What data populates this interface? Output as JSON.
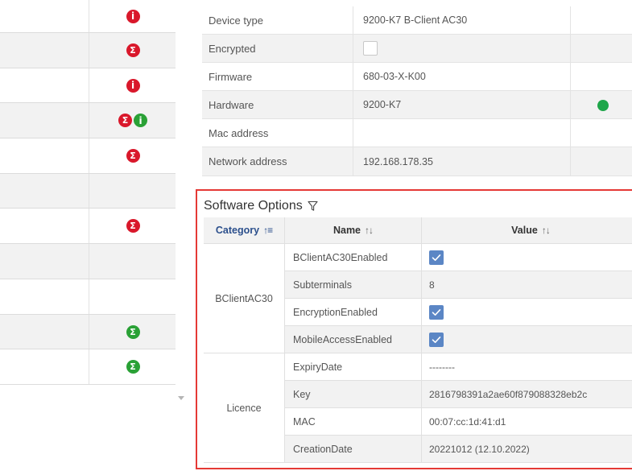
{
  "left_list": {
    "rows": [
      {
        "badges": [
          "info-red"
        ],
        "shaded": false
      },
      {
        "badges": [
          "sigma-red"
        ],
        "shaded": true
      },
      {
        "badges": [
          "info-red"
        ],
        "shaded": false
      },
      {
        "badges": [
          "sigma-red",
          "info-green"
        ],
        "shaded": true
      },
      {
        "badges": [
          "sigma-red"
        ],
        "shaded": false
      },
      {
        "badges": [],
        "shaded": true
      },
      {
        "badges": [
          "sigma-red"
        ],
        "shaded": false
      },
      {
        "badges": [],
        "shaded": true
      },
      {
        "badges": [],
        "shaded": false
      },
      {
        "badges": [
          "sigma-green"
        ],
        "shaded": true
      },
      {
        "badges": [
          "sigma-green"
        ],
        "shaded": false
      }
    ]
  },
  "device": {
    "rows": [
      {
        "label": "Device type",
        "value": "9200-K7 B-Client AC30",
        "kind": "text"
      },
      {
        "label": "Encrypted",
        "value": "",
        "kind": "checkbox",
        "checked": false
      },
      {
        "label": "Firmware",
        "value": "680-03-X-K00",
        "kind": "text"
      },
      {
        "label": "Hardware",
        "value": "9200-K7",
        "kind": "text",
        "status": "green"
      },
      {
        "label": "Mac address",
        "value": "",
        "kind": "text"
      },
      {
        "label": "Network address",
        "value": "192.168.178.35",
        "kind": "text"
      }
    ]
  },
  "software_options": {
    "title": "Software Options",
    "columns": {
      "category": "Category",
      "name": "Name",
      "value": "Value"
    },
    "groups": [
      {
        "category": "BClientAC30",
        "rows": [
          {
            "name": "BClientAC30Enabled",
            "kind": "checkbox",
            "checked": true
          },
          {
            "name": "Subterminals",
            "kind": "text",
            "value": "8"
          },
          {
            "name": "EncryptionEnabled",
            "kind": "checkbox",
            "checked": true
          },
          {
            "name": "MobileAccessEnabled",
            "kind": "checkbox",
            "checked": true
          }
        ]
      },
      {
        "category": "Licence",
        "rows": [
          {
            "name": "ExpiryDate",
            "kind": "text",
            "value": "--------"
          },
          {
            "name": "Key",
            "kind": "text",
            "value": "2816798391a2ae60f879088328eb2c"
          },
          {
            "name": "MAC",
            "kind": "text",
            "value": "00:07:cc:1d:41:d1"
          },
          {
            "name": "CreationDate",
            "kind": "text",
            "value": "20221012 (12.10.2022)"
          }
        ]
      }
    ]
  },
  "colors": {
    "badge_red": "#d9182b",
    "badge_green": "#2aa136",
    "status_green": "#1fa64a",
    "checkbox_checked": "#5b86c5",
    "highlight_border": "#e53935",
    "sorted_header": "#2b4f8c"
  }
}
